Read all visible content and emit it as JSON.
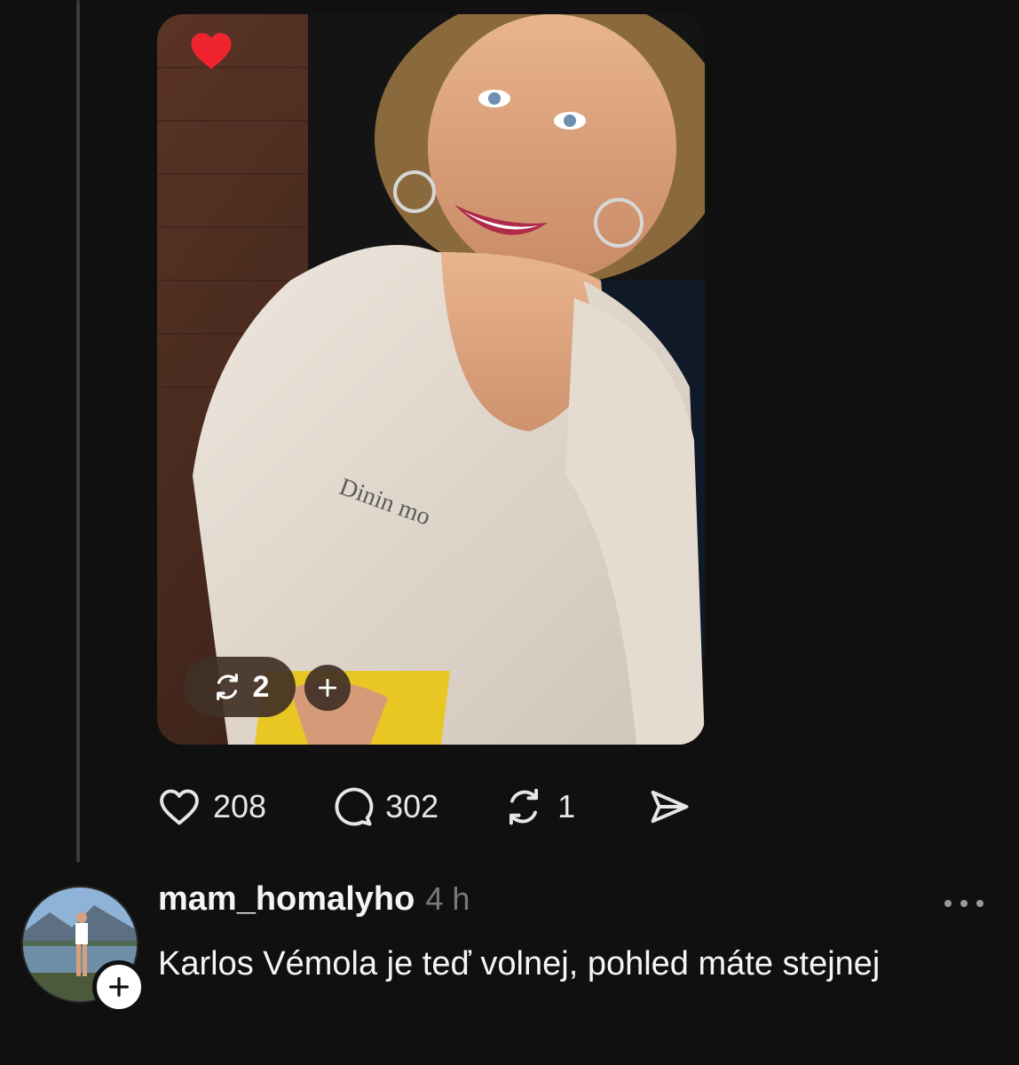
{
  "post": {
    "media": {
      "alt_icon": "photo",
      "reposts_label": "2",
      "reposts_icon": "repost-icon",
      "add_icon": "plus-icon",
      "liked_icon": "heart-filled-icon"
    },
    "actions": {
      "likes": "208",
      "comments": "302",
      "reposts": "1"
    }
  },
  "reply": {
    "username": "mam_homalyho",
    "timestamp": "4 h",
    "text": "Karlos Vémola je teď volnej, pohled máte stejnej"
  },
  "colors": {
    "background": "#101010",
    "heart": "#f0242f",
    "muted": "#7a7a7a"
  }
}
